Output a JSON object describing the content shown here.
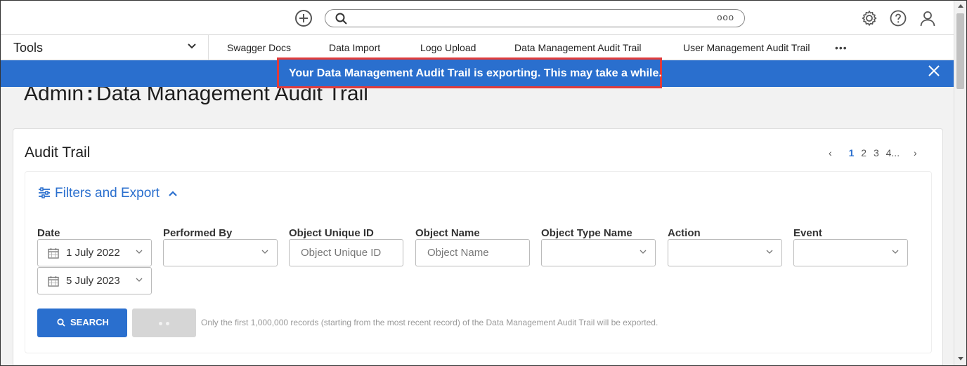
{
  "header": {
    "search_more": "ooo",
    "icons": [
      "add-icon",
      "search-icon",
      "gear-icon",
      "help-icon",
      "user-icon"
    ]
  },
  "nav": {
    "tools_label": "Tools",
    "links": [
      "Swagger Docs",
      "Data Import",
      "Logo Upload",
      "Data Management Audit Trail",
      "User Management Audit Trail"
    ],
    "more": "•••"
  },
  "banner": {
    "message": "Your Data Management Audit Trail is exporting. This may take a while.",
    "color": "#2a6fce",
    "highlight_color": "#e03b3b"
  },
  "page": {
    "title_prefix": "Admin",
    "title_sep": ":",
    "title": "Data Management Audit Trail"
  },
  "card": {
    "title": "Audit Trail",
    "pager": {
      "prev": "‹",
      "pages": [
        "1",
        "2",
        "3",
        "4"
      ],
      "ellipsis": "...",
      "next": "›",
      "current": "1"
    },
    "filters_label": "Filters and Export",
    "filters": {
      "date_label": "Date",
      "date_from": "1 July 2022",
      "date_to": "5 July 2023",
      "performed_by_label": "Performed By",
      "object_uid_label": "Object Unique ID",
      "object_uid_placeholder": "Object Unique ID",
      "object_name_label": "Object Name",
      "object_name_placeholder": "Object Name",
      "object_type_label": "Object Type Name",
      "action_label": "Action",
      "event_label": "Event"
    },
    "search_button": "SEARCH",
    "export_note": "Only the first 1,000,000 records (starting from the most recent record) of the Data Management Audit Trail will be exported."
  }
}
